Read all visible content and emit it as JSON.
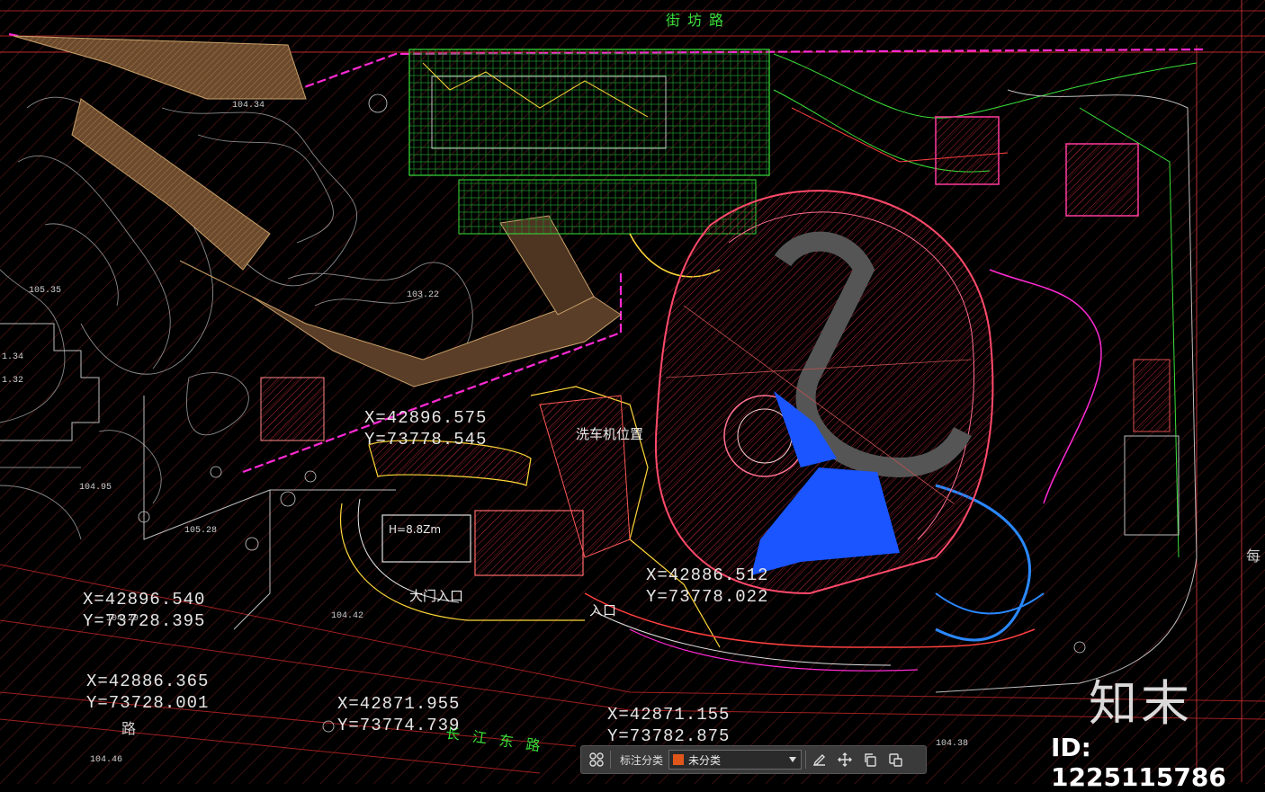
{
  "drawing": {
    "roads": [
      "街坊路",
      "长江东路",
      "路",
      "每"
    ],
    "coords": [
      [
        "X=42896.575",
        "Y=73778.545"
      ],
      [
        "X=42886.512",
        "Y=73778.022"
      ],
      [
        "X=42896.540",
        "Y=73728.395"
      ],
      [
        "X=42886.365",
        "Y=73728.001"
      ],
      [
        "X=42871.955",
        "Y=73774.739"
      ],
      [
        "X=42871.155",
        "Y=73782.875"
      ]
    ],
    "labels": {
      "wash": "洗车机位置",
      "gate_main": "大门入口",
      "gate2": "入口",
      "height": "H=8.8Zm"
    },
    "elevations": [
      "104.34",
      "105.35",
      "103.22",
      "104.95",
      "105.28",
      "104.29",
      "104.42",
      "104.46",
      "104.38",
      "1.34",
      "1.32"
    ]
  },
  "toolbar": {
    "label": "标注分类",
    "select_value": "未分类",
    "swatch_color": "#e0561a"
  },
  "watermark": {
    "brand": "知末",
    "id": "ID: 1225115786"
  },
  "colors": {
    "background": "#000000",
    "hatch": "#5a1a1a",
    "blue_fill": "#1a55ff",
    "magenta": "#ff2ad4",
    "green": "#3adf3a"
  }
}
